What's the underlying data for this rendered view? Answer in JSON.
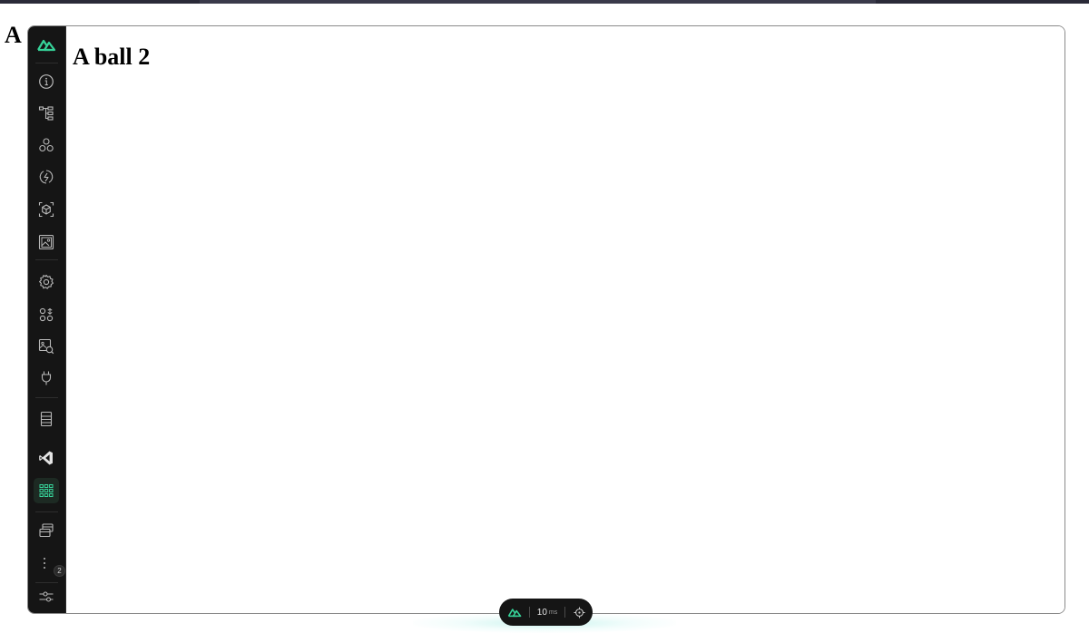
{
  "page": {
    "heading": "A"
  },
  "content": {
    "title": "A ball 2"
  },
  "sidebar": {
    "items": [
      {
        "name": "overview-icon"
      },
      {
        "name": "pages-tree-icon"
      },
      {
        "name": "components-icon"
      },
      {
        "name": "imports-icon"
      },
      {
        "name": "modules-icon"
      },
      {
        "name": "assets-icon"
      },
      {
        "name": "runtime-config-icon"
      },
      {
        "name": "payload-icon"
      },
      {
        "name": "open-graph-icon"
      },
      {
        "name": "plugins-icon"
      },
      {
        "name": "storage-icon"
      },
      {
        "name": "vscode-icon"
      },
      {
        "name": "custom-tab-grid-icon"
      },
      {
        "name": "split-screen-icon"
      },
      {
        "name": "more-icon"
      },
      {
        "name": "settings-icon"
      }
    ],
    "more_badge": "2"
  },
  "bottom_pill": {
    "render_time_value": "10",
    "render_time_unit": "ms"
  },
  "colors": {
    "accent_green": "#36d399",
    "sidebar_bg": "#151515",
    "icon_gray": "#b9b9b9"
  }
}
